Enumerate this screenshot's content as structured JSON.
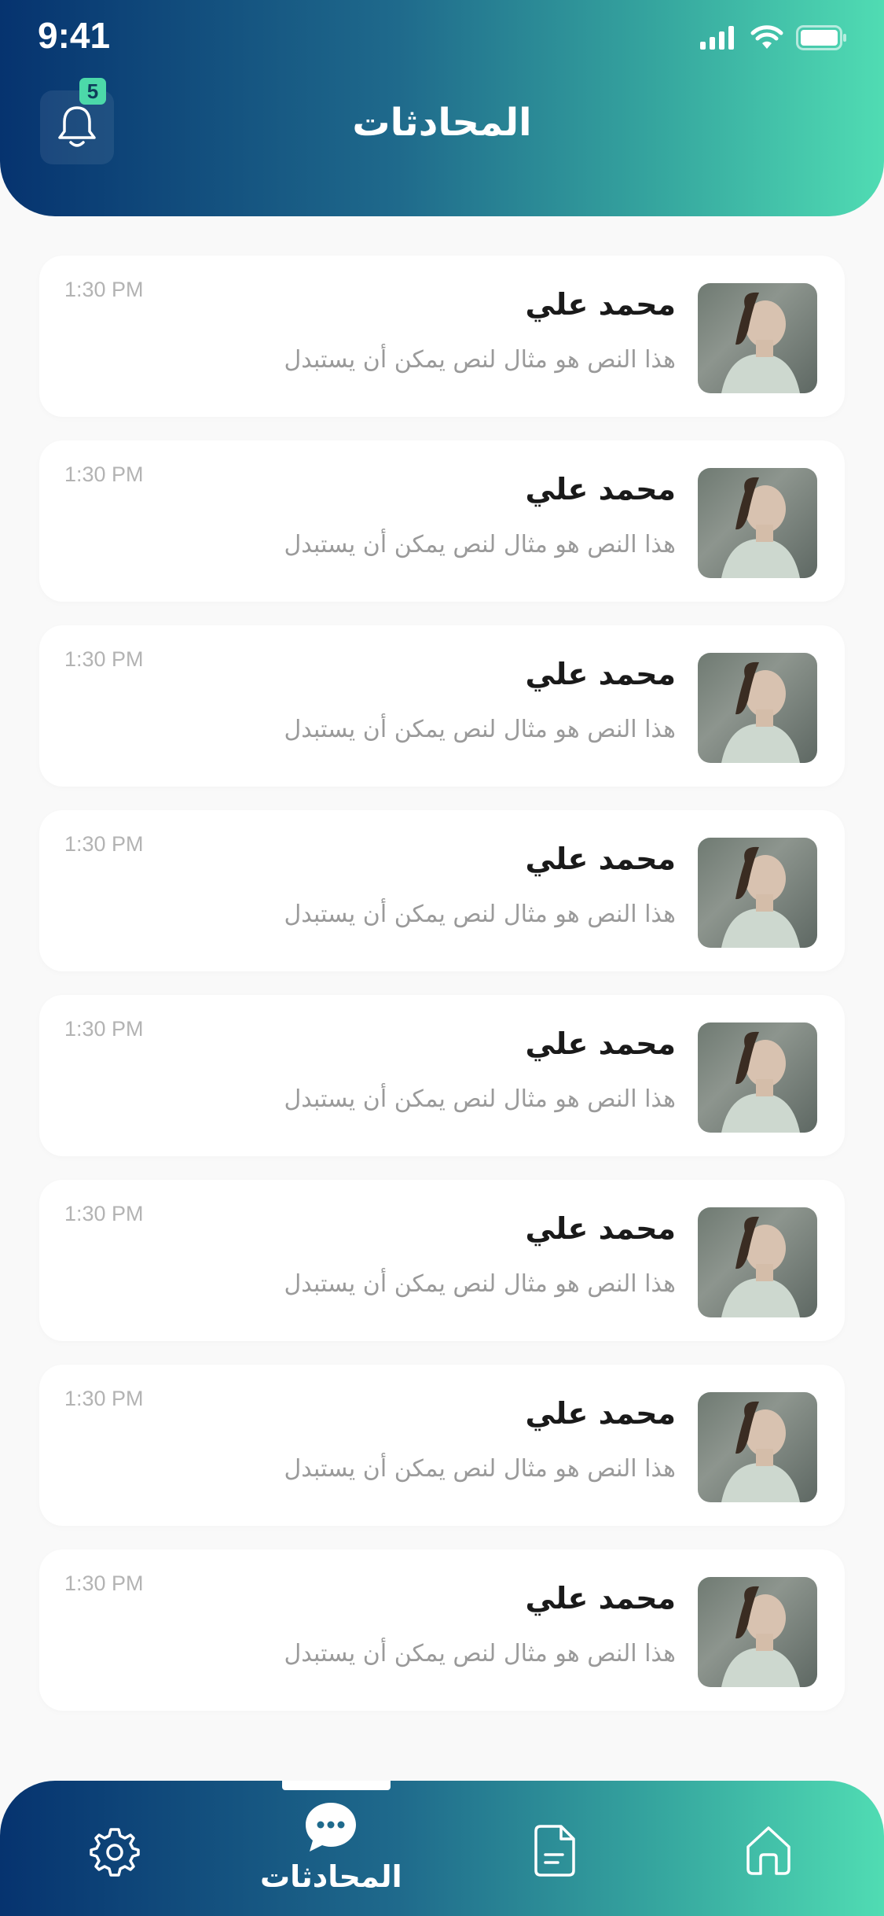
{
  "status_bar": {
    "time": "9:41"
  },
  "header": {
    "title": "المحادثات",
    "notification_count": "5"
  },
  "conversations": [
    {
      "name": "محمد علي",
      "message": "هذا النص هو مثال لنص يمكن أن يستبدل",
      "time": "1:30 PM"
    },
    {
      "name": "محمد علي",
      "message": "هذا النص هو مثال لنص يمكن أن يستبدل",
      "time": "1:30 PM"
    },
    {
      "name": "محمد علي",
      "message": "هذا النص هو مثال لنص يمكن أن يستبدل",
      "time": "1:30 PM"
    },
    {
      "name": "محمد علي",
      "message": "هذا النص هو مثال لنص يمكن أن يستبدل",
      "time": "1:30 PM"
    },
    {
      "name": "محمد علي",
      "message": "هذا النص هو مثال لنص يمكن أن يستبدل",
      "time": "1:30 PM"
    },
    {
      "name": "محمد علي",
      "message": "هذا النص هو مثال لنص يمكن أن يستبدل",
      "time": "1:30 PM"
    },
    {
      "name": "محمد علي",
      "message": "هذا النص هو مثال لنص يمكن أن يستبدل",
      "time": "1:30 PM"
    },
    {
      "name": "محمد علي",
      "message": "هذا النص هو مثال لنص يمكن أن يستبدل",
      "time": "1:30 PM"
    }
  ],
  "bottom_nav": {
    "items": [
      {
        "icon": "gear-icon",
        "label": ""
      },
      {
        "icon": "chat-icon",
        "label": "المحادثات",
        "active": true
      },
      {
        "icon": "document-icon",
        "label": ""
      },
      {
        "icon": "home-icon",
        "label": ""
      }
    ]
  },
  "colors": {
    "gradient_start": "#06336f",
    "gradient_end": "#50dcb3",
    "badge": "#4cd9a9"
  }
}
